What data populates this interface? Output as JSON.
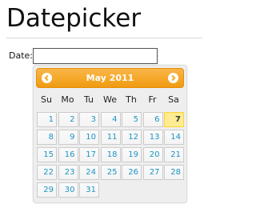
{
  "page": {
    "title": "Datepicker"
  },
  "form": {
    "date_label": "Date:",
    "date_value": ""
  },
  "datepicker": {
    "month_title": "May 2011",
    "prev_icon": "chevron-left-icon",
    "next_icon": "chevron-right-icon",
    "weekdays": [
      "Su",
      "Mo",
      "Tu",
      "We",
      "Th",
      "Fr",
      "Sa"
    ],
    "today": "7",
    "weeks": [
      [
        "",
        "",
        "",
        "",
        "",
        "",
        ""
      ],
      [
        "1",
        "2",
        "3",
        "4",
        "5",
        "6",
        "7"
      ],
      [
        "8",
        "9",
        "10",
        "11",
        "12",
        "13",
        "14"
      ],
      [
        "15",
        "16",
        "17",
        "18",
        "19",
        "20",
        "21"
      ],
      [
        "22",
        "23",
        "24",
        "25",
        "26",
        "27",
        "28"
      ],
      [
        "29",
        "30",
        "31",
        "",
        "",
        "",
        ""
      ]
    ],
    "colors": {
      "header": "#f6a828",
      "day_text": "#1c94c4",
      "today_bg": "#fdec93"
    }
  }
}
